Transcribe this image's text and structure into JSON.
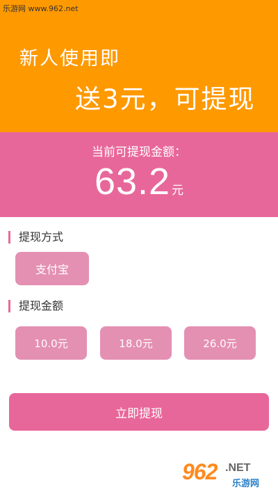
{
  "watermark": {
    "site_text": "乐游网 www.962.net"
  },
  "banner": {
    "line1": "新人使用即",
    "line2": "送3元，可提现",
    "bg_color": "#FF9900"
  },
  "balance": {
    "label": "当前可提现金额：",
    "amount": "63.2",
    "unit": "元",
    "bg_color": "#E8679A"
  },
  "withdraw_method": {
    "title": "提现方式",
    "options": [
      "支付宝"
    ]
  },
  "withdraw_amount": {
    "title": "提现金额",
    "options": [
      "10.0元",
      "18.0元",
      "26.0元"
    ]
  },
  "submit": {
    "label": "立即提现"
  },
  "logo": {
    "number": "962",
    "suffix": ".NET",
    "name": "乐游网"
  }
}
